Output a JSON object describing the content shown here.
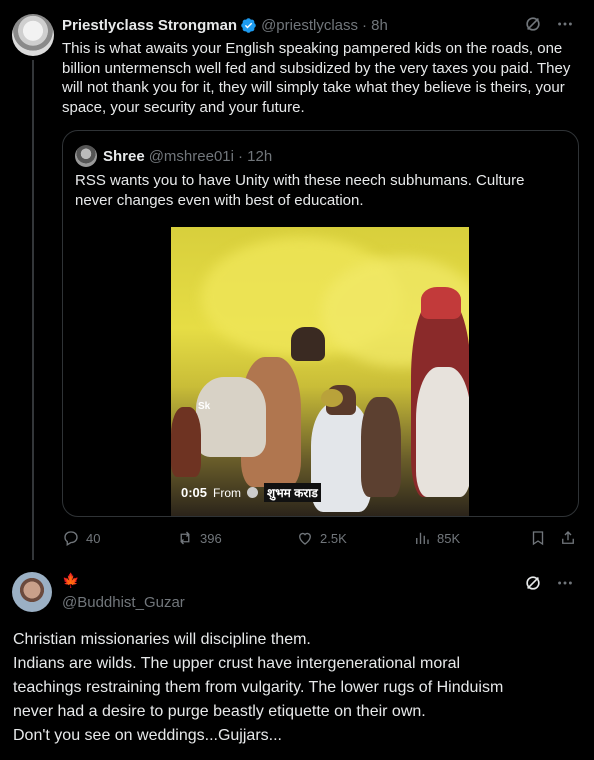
{
  "post": {
    "author_name": "Priestlyclass Strongman",
    "author_handle": "@priestlyclass",
    "time": "· 8h",
    "text": "This is what awaits your English speaking pampered kids on the roads, one billion untermensch well fed and subsidized by the very taxes you paid. They will not thank you for it, they will simply take what they believe is theirs, your space, your security and your future.",
    "quote": {
      "author_name": "Shree",
      "author_handle": "@mshree01i",
      "time": "· 12h",
      "text": "RSS wants you to have Unity with these neech subhumans. Culture never changes even with best of education.",
      "video": {
        "overlay_label": "Sk",
        "duration": "0:05",
        "from_label": "From",
        "from_user": "शुभम कराड"
      }
    },
    "actions": {
      "replies": "40",
      "reposts": "396",
      "likes": "2.5K",
      "views": "85K"
    }
  },
  "reply": {
    "flag_glyph": "🍁",
    "handle": "@Buddhist_Guzar",
    "lines": [
      "Christian missionaries will discipline them.",
      "Indians are wilds. The upper crust have intergenerational moral",
      "teachings restraining them from vulgarity. The lower rugs of Hinduism",
      "never had a desire to purge beastly etiquette on their own.",
      "Don't you see on weddings...Gujjars..."
    ]
  },
  "icons": {
    "grok": "grok-icon",
    "more": "more-icon",
    "reply": "reply-icon",
    "repost": "repost-icon",
    "like": "like-icon",
    "views": "views-icon",
    "bookmark": "bookmark-icon",
    "share": "share-icon"
  },
  "colors": {
    "background": "#000000",
    "text": "#e7e9ea",
    "muted": "#71767b",
    "verified": "#1d9bf0",
    "border": "#2f3336"
  }
}
